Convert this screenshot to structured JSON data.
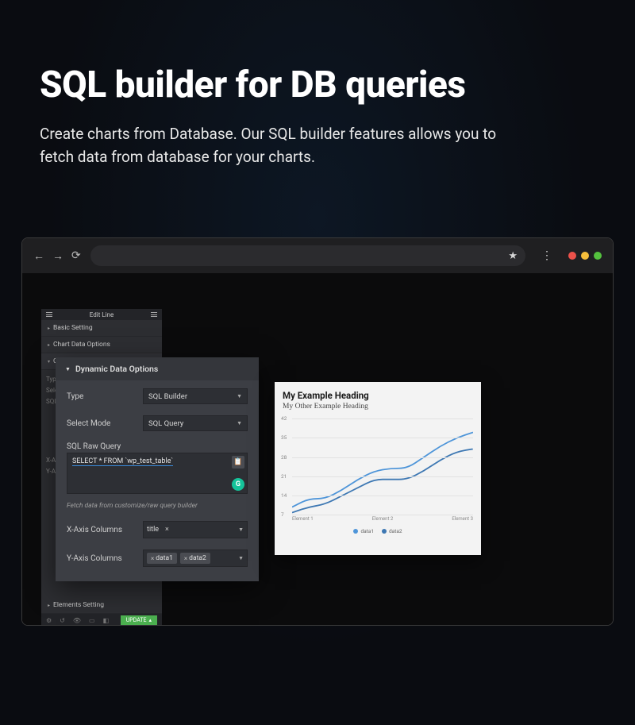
{
  "hero": {
    "title": "SQL builder for DB queries",
    "subtitle": "Create charts from Database. Our SQL builder features allows you to fetch data from database for your charts."
  },
  "browser": {
    "star": "★",
    "vdots": "⋮"
  },
  "panel": {
    "title": "Edit Line",
    "rows": {
      "basic": "Basic Setting",
      "chartdata": "Chart Data Options",
      "elements": "Elements Setting"
    },
    "partial": {
      "c": "C",
      "type": "Type",
      "sele": "Sele",
      "sql": "SQL",
      "xax": "X-Ax",
      "yax": "Y-Ax"
    },
    "footer": {
      "update": "UPDATE"
    }
  },
  "pop": {
    "title": "Dynamic Data Options",
    "type_label": "Type",
    "type_value": "SQL Builder",
    "mode_label": "Select Mode",
    "mode_value": "SQL Query",
    "raw_label": "SQL Raw Query",
    "raw_value": "SELECT * FROM `wp_test_table`",
    "helper": "Fetch data from customize/raw query builder",
    "xcol_label": "X-Axis Columns",
    "xcol_tag": "title",
    "ycol_label": "Y-Axis Columns",
    "ycol_tags": [
      "data1",
      "data2"
    ],
    "gram": "G",
    "copy": "📋"
  },
  "chart_data": {
    "type": "line",
    "title": "My Example Heading",
    "subtitle": "My Other Example Heading",
    "ylim": [
      7,
      42
    ],
    "yticks": [
      7,
      14,
      21,
      28,
      35,
      42
    ],
    "categories": [
      "Element 1",
      "Element 2",
      "Element 3"
    ],
    "series": [
      {
        "name": "data1",
        "values": [
          10,
          13,
          13,
          16,
          20,
          23,
          24,
          24,
          28,
          32,
          35,
          37
        ],
        "color": "#4e95d9"
      },
      {
        "name": "data2",
        "values": [
          8,
          10,
          11,
          14,
          17,
          20,
          20,
          20,
          23,
          27,
          30,
          31
        ],
        "color": "#3e78b3"
      }
    ]
  }
}
